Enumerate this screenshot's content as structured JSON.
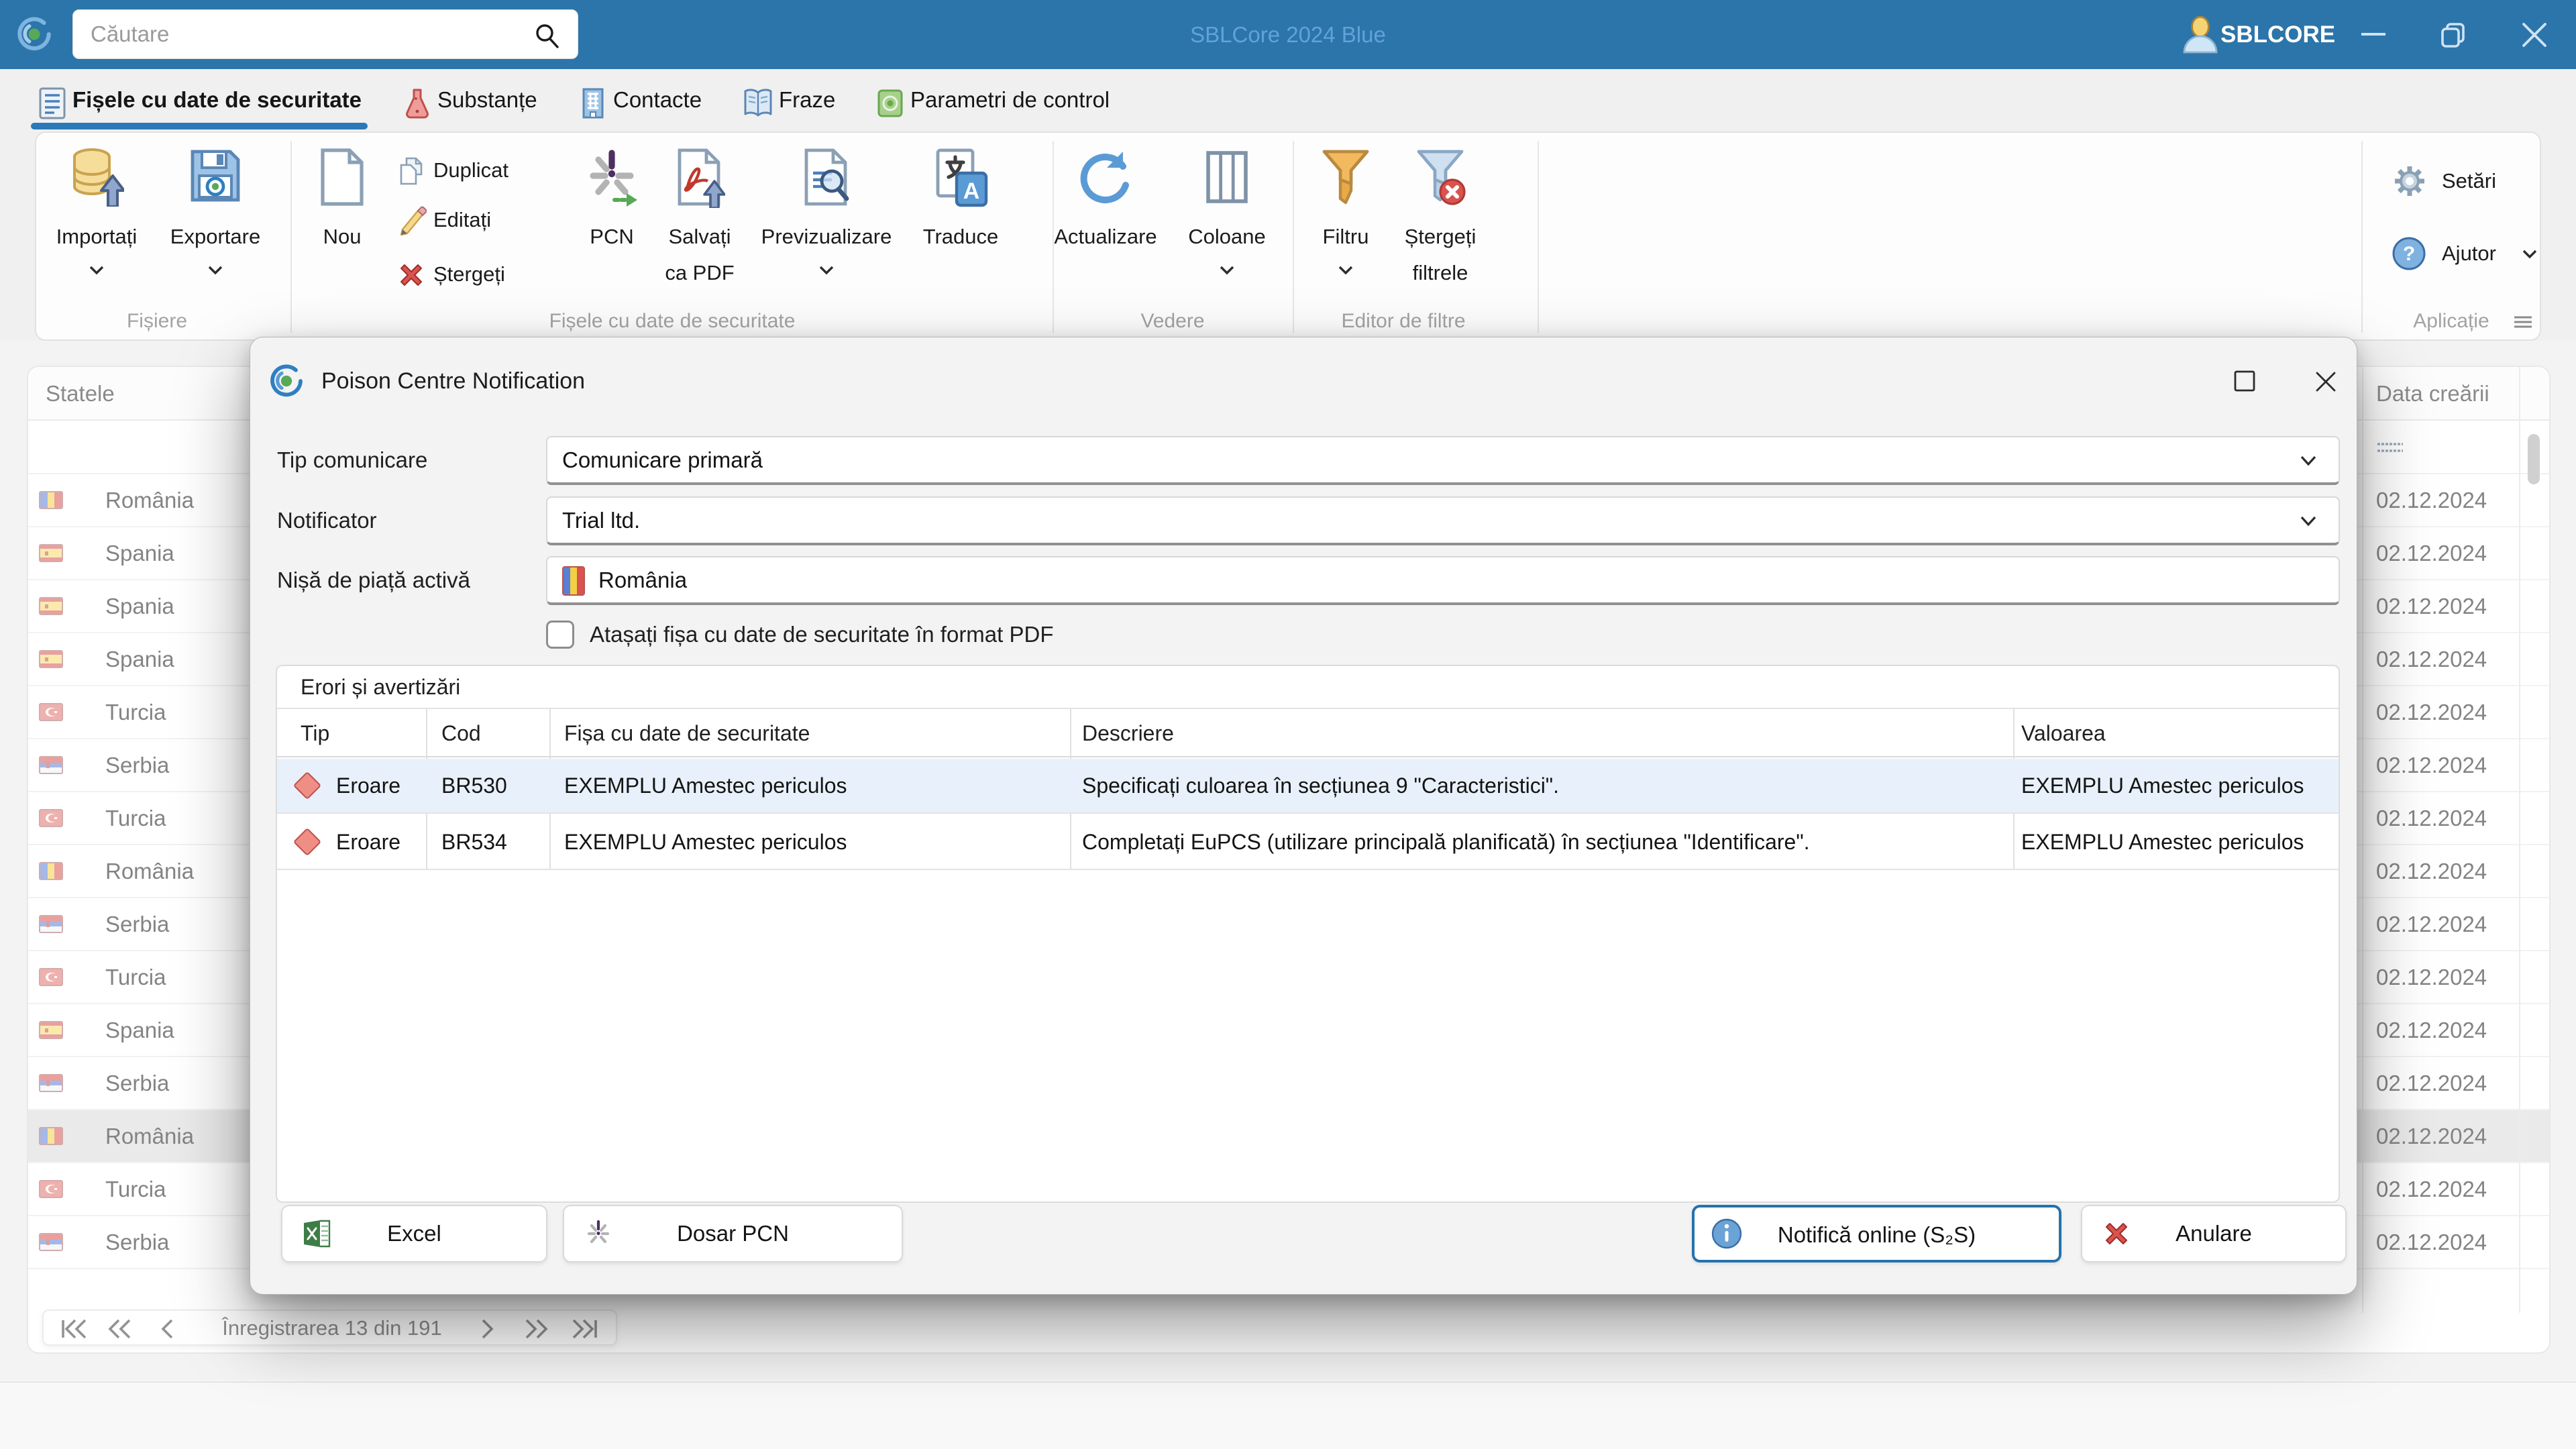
{
  "window": {
    "search_placeholder": "Căutare",
    "title": "SBLCore 2024 Blue",
    "account": "SBLCORE"
  },
  "tabs": [
    {
      "label": "Fișele cu date de securitate"
    },
    {
      "label": "Substanțe"
    },
    {
      "label": "Contacte"
    },
    {
      "label": "Fraze"
    },
    {
      "label": "Parametri de control"
    }
  ],
  "ribbon": {
    "groups": [
      {
        "label": "Fișiere"
      },
      {
        "label": "Fișele cu date de securitate"
      },
      {
        "label": "Vedere"
      },
      {
        "label": "Editor de filtre"
      },
      {
        "label": "Aplicație"
      }
    ],
    "items": {
      "import": "Importați",
      "export": "Exportare",
      "new": "Nou",
      "duplicate": "Duplicat",
      "edit": "Editați",
      "delete": "Ștergeți",
      "pcn": "PCN",
      "save_pdf_1": "Salvați",
      "save_pdf_2": "ca PDF",
      "preview": "Previzualizare",
      "translate": "Traduce",
      "refresh": "Actualizare",
      "columns": "Coloane",
      "filter": "Filtru",
      "clear_filters_1": "Ștergeți",
      "clear_filters_2": "filtrele",
      "settings": "Setări",
      "help": "Ajutor"
    }
  },
  "table": {
    "country_header": "Statele",
    "date_header": "Data creării",
    "rows": [
      {
        "country": "România",
        "flag": "ro",
        "date": "02.12.2024",
        "selected": false
      },
      {
        "country": "Spania",
        "flag": "es",
        "date": "02.12.2024",
        "selected": false
      },
      {
        "country": "Spania",
        "flag": "es",
        "date": "02.12.2024",
        "selected": false
      },
      {
        "country": "Spania",
        "flag": "es",
        "date": "02.12.2024",
        "selected": false
      },
      {
        "country": "Turcia",
        "flag": "tr",
        "date": "02.12.2024",
        "selected": false
      },
      {
        "country": "Serbia",
        "flag": "rs",
        "date": "02.12.2024",
        "selected": false
      },
      {
        "country": "Turcia",
        "flag": "tr",
        "date": "02.12.2024",
        "selected": false
      },
      {
        "country": "România",
        "flag": "ro",
        "date": "02.12.2024",
        "selected": false
      },
      {
        "country": "Serbia",
        "flag": "rs",
        "date": "02.12.2024",
        "selected": false
      },
      {
        "country": "Turcia",
        "flag": "tr",
        "date": "02.12.2024",
        "selected": false
      },
      {
        "country": "Spania",
        "flag": "es",
        "date": "02.12.2024",
        "selected": false
      },
      {
        "country": "Serbia",
        "flag": "rs",
        "date": "02.12.2024",
        "selected": false
      },
      {
        "country": "România",
        "flag": "ro",
        "date": "02.12.2024",
        "selected": true
      },
      {
        "country": "Turcia",
        "flag": "tr",
        "date": "02.12.2024",
        "selected": false
      },
      {
        "country": "Serbia",
        "flag": "rs",
        "date": "02.12.2024",
        "selected": false
      }
    ]
  },
  "pager": {
    "label": "Înregistrarea 13 din 191"
  },
  "dialog": {
    "title": "Poison Centre Notification",
    "fields": {
      "tip_label": "Tip comunicare",
      "tip_value": "Comunicare primară",
      "notificator_label": "Notificator",
      "notificator_value": "Trial ltd.",
      "nisa_label": "Nișă de piață activă",
      "nisa_value": "România",
      "checkbox_label": "Atașați fișa cu date de securitate în format PDF"
    },
    "errors": {
      "group_title": "Erori și avertizări",
      "headers": [
        "Tip",
        "Cod",
        "Fișa cu date de securitate",
        "Descriere",
        "Valoarea"
      ],
      "rows": [
        {
          "tip": "Eroare",
          "cod": "BR530",
          "fisa": "EXEMPLU Amestec periculos",
          "descriere": "Specificați culoarea în secțiunea 9 \"Caracteristici\".",
          "valoarea": "EXEMPLU Amestec periculos"
        },
        {
          "tip": "Eroare",
          "cod": "BR534",
          "fisa": "EXEMPLU Amestec periculos",
          "descriere": "Completați EuPCS (utilizare principală planificată) în secțiunea \"Identificare\".",
          "valoarea": "EXEMPLU Amestec periculos"
        }
      ]
    },
    "buttons": {
      "excel": "Excel",
      "dosar": "Dosar PCN",
      "notify": "Notifică online (S₂S)",
      "cancel": "Anulare"
    }
  }
}
